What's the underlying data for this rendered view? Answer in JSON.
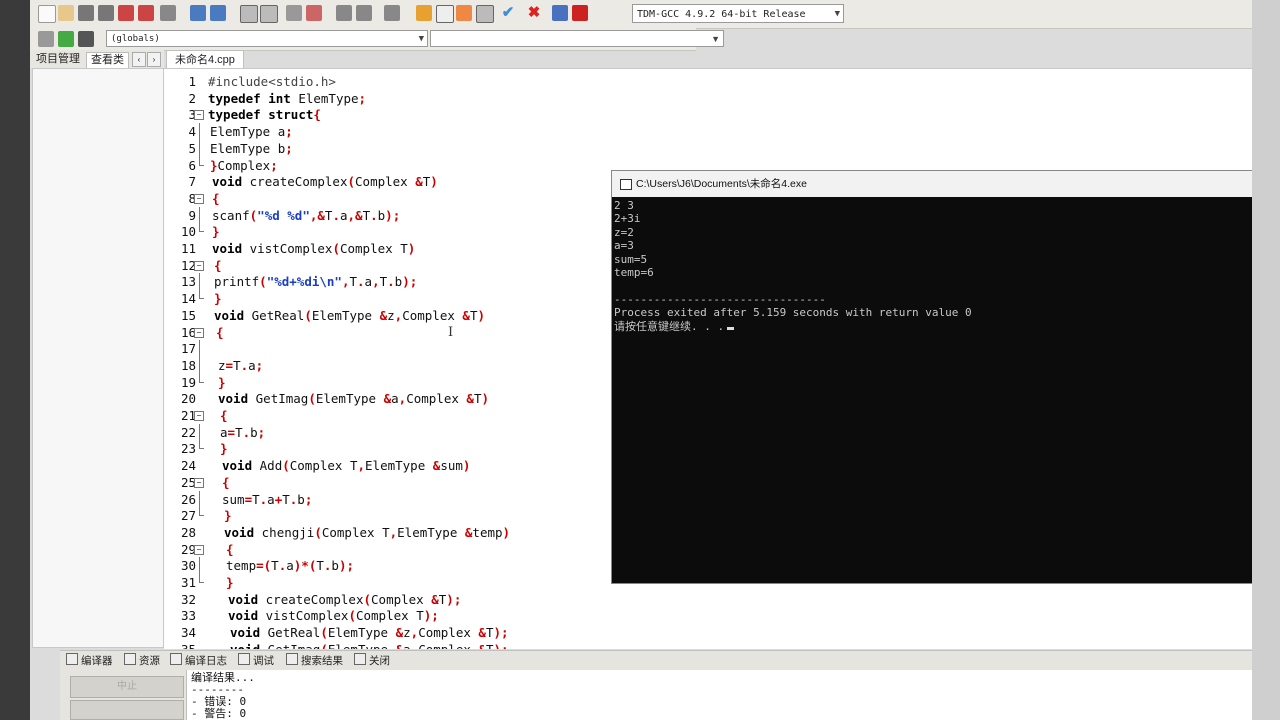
{
  "toolbar": {
    "compiler_label": "TDM-GCC 4.9.2 64-bit Release",
    "scope_label": "(globals)",
    "member_label": ""
  },
  "left_panel": {
    "tabs": [
      "项目管理",
      "查看类"
    ],
    "nav_prev": "‹",
    "nav_next": "›"
  },
  "editor": {
    "tab_label": "未命名4.cpp",
    "lines": [
      {
        "n": "1",
        "text": "#include<stdio.h>"
      },
      {
        "n": "2",
        "text": "typedef int ElemType;"
      },
      {
        "n": "3",
        "text": "typedef struct{"
      },
      {
        "n": "4",
        "text": "ElemType a;"
      },
      {
        "n": "5",
        "text": "ElemType b;"
      },
      {
        "n": "6",
        "text": "}Complex;"
      },
      {
        "n": "7",
        "text": "void createComplex(Complex &T)"
      },
      {
        "n": "8",
        "text": "{"
      },
      {
        "n": "9",
        "text": "scanf(\"%d %d\",&T.a,&T.b);"
      },
      {
        "n": "10",
        "text": "}"
      },
      {
        "n": "11",
        "text": "void vistComplex(Complex T)"
      },
      {
        "n": "12",
        "text": "{"
      },
      {
        "n": "13",
        "text": "printf(\"%d+%di\\n\",T.a,T.b);"
      },
      {
        "n": "14",
        "text": "}"
      },
      {
        "n": "15",
        "text": "void GetReal(ElemType &z,Complex &T)"
      },
      {
        "n": "16",
        "text": "{"
      },
      {
        "n": "17",
        "text": ""
      },
      {
        "n": "18",
        "text": "z=T.a;"
      },
      {
        "n": "19",
        "text": "}"
      },
      {
        "n": "20",
        "text": "void GetImag(ElemType &a,Complex &T)"
      },
      {
        "n": "21",
        "text": "{"
      },
      {
        "n": "22",
        "text": "a=T.b;"
      },
      {
        "n": "23",
        "text": "}"
      },
      {
        "n": "24",
        "text": "void Add(Complex T,ElemType &sum)"
      },
      {
        "n": "25",
        "text": "{"
      },
      {
        "n": "26",
        "text": "sum=T.a+T.b;"
      },
      {
        "n": "27",
        "text": "}"
      },
      {
        "n": "28",
        "text": "void chengji(Complex T,ElemType &temp)"
      },
      {
        "n": "29",
        "text": "{"
      },
      {
        "n": "30",
        "text": "temp=(T.a)*(T.b);"
      },
      {
        "n": "31",
        "text": "}"
      },
      {
        "n": "32",
        "text": "void createComplex(Complex &T);"
      },
      {
        "n": "33",
        "text": "void vistComplex(Complex T);"
      },
      {
        "n": "34",
        "text": "void GetReal(ElemType &z,Complex &T);"
      },
      {
        "n": "35",
        "text": "void GetImag(ElemType &a,Complex &T);"
      }
    ]
  },
  "console": {
    "title": "C:\\Users\\J6\\Documents\\未命名4.exe",
    "lines": [
      "2 3",
      "2+3i",
      "z=2",
      "a=3",
      "sum=5",
      "temp=6",
      "",
      "--------------------------------",
      "Process exited after 5.159 seconds with return value 0",
      "请按任意键继续. . ."
    ]
  },
  "bottom": {
    "tabs": [
      "编译器",
      "资源",
      "编译日志",
      "调试",
      "搜索结果",
      "关闭"
    ],
    "abort_label": "中止",
    "log_lines": [
      "编译结果...",
      "--------",
      "- 错误: 0",
      "- 警告: 0"
    ]
  }
}
